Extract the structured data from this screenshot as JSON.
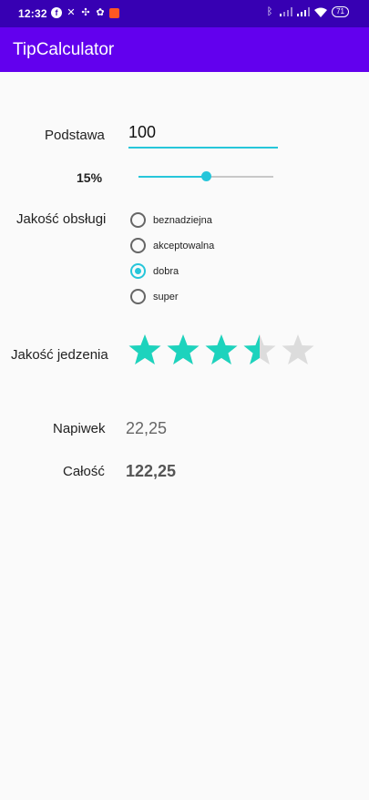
{
  "status_bar": {
    "time": "12:32",
    "battery": "71"
  },
  "app_bar": {
    "title": "TipCalculator"
  },
  "form": {
    "base_label": "Podstawa",
    "base_value": "100",
    "tip_percent_label": "15%",
    "tip_slider_fraction": 0.5,
    "service_label": "Jakość obsługi",
    "service_options": [
      "beznadziejna",
      "akceptowalna",
      "dobra",
      "super"
    ],
    "service_selected": "dobra",
    "food_label": "Jakość jedzenia",
    "food_rating": 3.5,
    "food_rating_max": 5
  },
  "results": {
    "tip_label": "Napiwek",
    "tip_value": "22,25",
    "total_label": "Całość",
    "total_value": "122,25"
  },
  "colors": {
    "status_bar": "#3700b3",
    "app_bar": "#6200ee",
    "accent": "#26c6da",
    "star_filled": "#1dd3bd",
    "star_empty": "#dcdcdc"
  },
  "icons": {
    "status_left": [
      "facebook-icon",
      "x-icon",
      "pinwheel-icon",
      "flower-icon",
      "notification-square-icon"
    ],
    "status_right": [
      "bluetooth-icon",
      "signal-icon",
      "signal-icon",
      "wifi-icon",
      "battery-icon"
    ]
  }
}
